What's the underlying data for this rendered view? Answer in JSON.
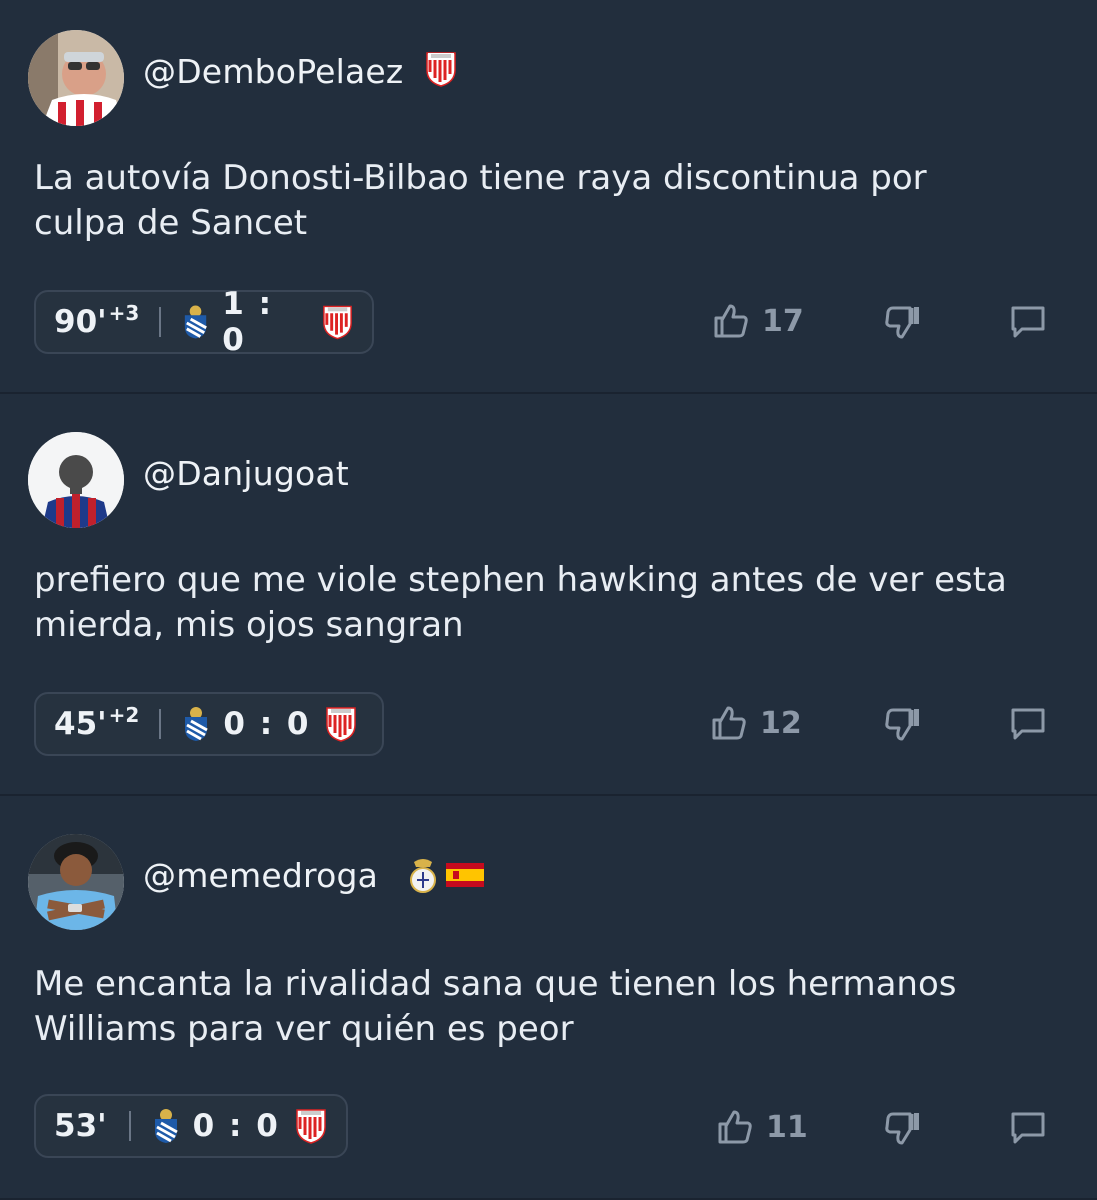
{
  "posts": [
    {
      "username": "@DemboPelaez",
      "badges": [
        "athletic-club-crest"
      ],
      "text": "La autovía Donosti-Bilbao tiene raya discontinua por\nculpa de Sancet",
      "minute": "90'",
      "stoppage": "+3",
      "home": "real-sociedad-crest",
      "score": "1 : 0",
      "away": "athletic-club-crest",
      "likes": "17"
    },
    {
      "username": "@Danjugoat",
      "badges": [],
      "text": "prefiero que me viole stephen hawking antes de ver esta\nmierda, mis ojos sangran",
      "minute": "45'",
      "stoppage": "+2",
      "home": "real-sociedad-crest",
      "score": "0 : 0",
      "away": "athletic-club-crest",
      "likes": "12"
    },
    {
      "username": "@memedroga",
      "badges": [
        "real-madrid-crest",
        "spain-flag"
      ],
      "text": "Me encanta la rivalidad sana que tienen los hermanos\nWilliams para ver quién es peor",
      "minute": "53'",
      "stoppage": "",
      "home": "real-sociedad-crest",
      "score": "0 : 0",
      "away": "athletic-club-crest",
      "likes": "11"
    }
  ],
  "colors": {
    "background": "#222e3d",
    "divider": "#1a2330",
    "icon": "#8d99a8"
  }
}
